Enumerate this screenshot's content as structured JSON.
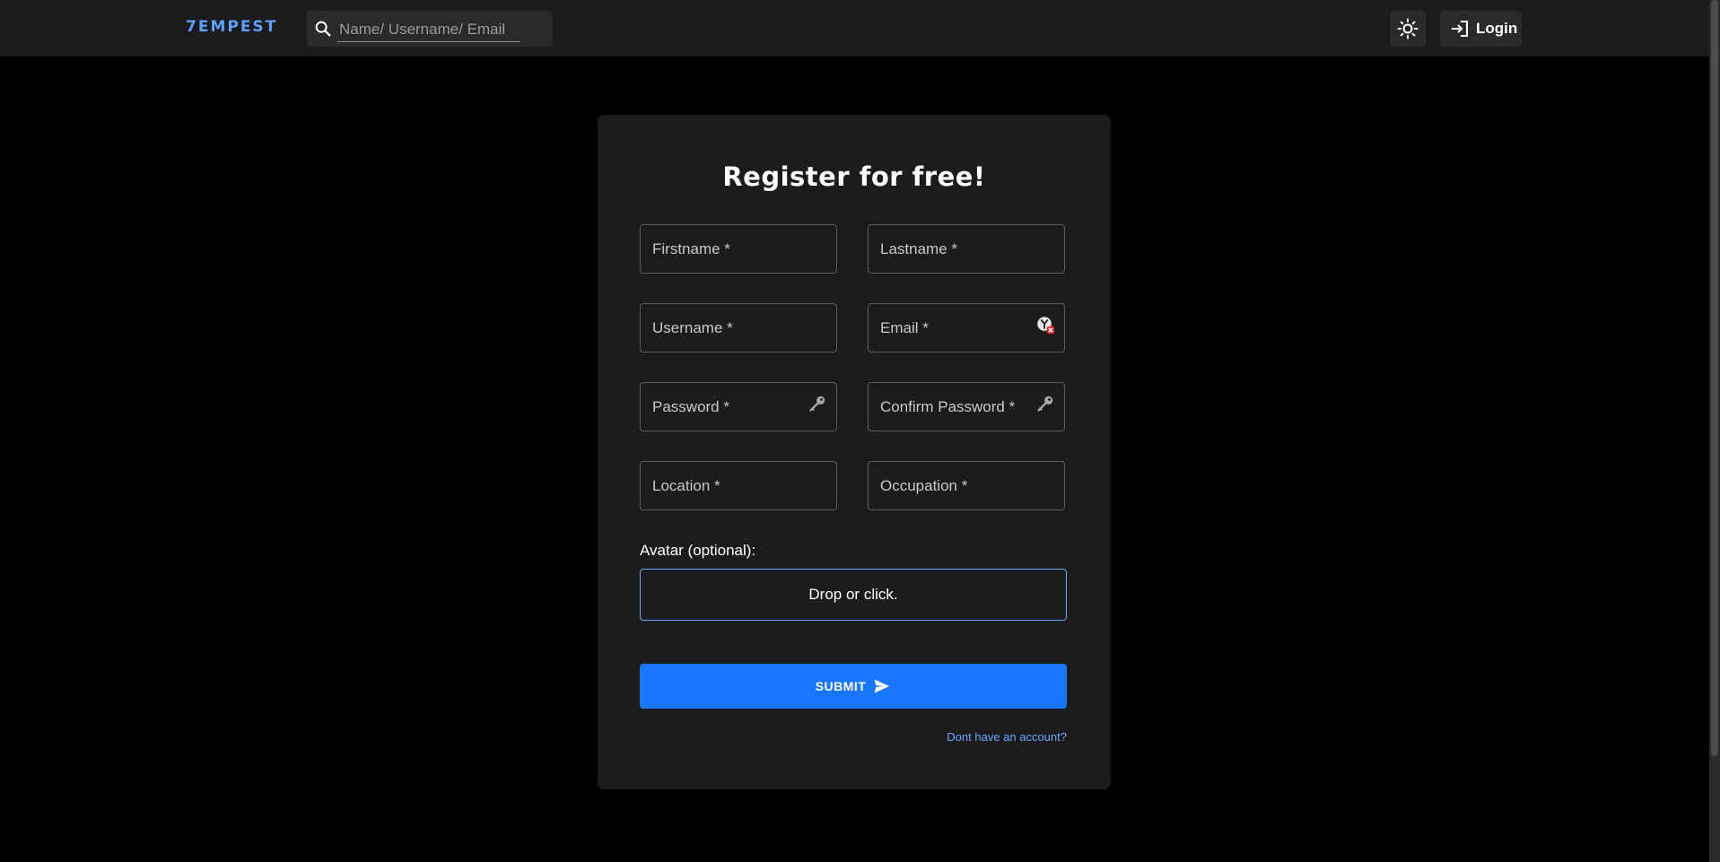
{
  "colors": {
    "page_bg": "#000000",
    "navbar_bg": "#1c1c1e",
    "card_bg": "#1c1c1e",
    "brand": "#5fa0ff",
    "primary": "#1976ff",
    "link": "#6aa6ff"
  },
  "navbar": {
    "brand": "7EMPEST",
    "search": {
      "placeholder": "Name/ Username/ Email",
      "value": "",
      "icon": "search-icon"
    },
    "theme_toggle_icon": "sun-icon",
    "login": {
      "label": "Login",
      "icon": "login-icon"
    }
  },
  "form": {
    "title": "Register for free!",
    "fields": [
      {
        "label": "Firstname *"
      },
      {
        "label": "Lastname *"
      },
      {
        "label": "Username *"
      },
      {
        "label": "Email *",
        "adornment_icon": "autofill-warning-icon"
      },
      {
        "label": "Password *",
        "adornment_icon": "key-icon"
      },
      {
        "label": "Confirm Password *",
        "adornment_icon": "key-icon"
      },
      {
        "label": "Location *"
      },
      {
        "label": "Occupation *"
      }
    ],
    "avatar": {
      "label": "Avatar (optional):",
      "dropzone_text": "Drop or click."
    },
    "submit": {
      "label": "SUBMIT",
      "icon": "send-icon"
    },
    "account_link": "Dont have an account?"
  }
}
